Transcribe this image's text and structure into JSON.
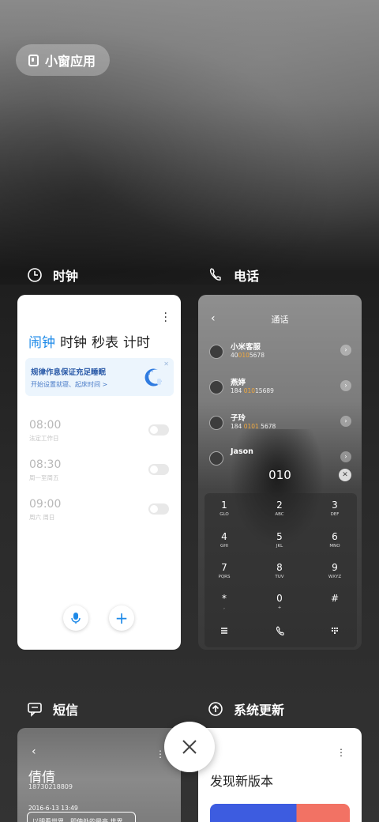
{
  "top": {
    "small_window_label": "小窗应用"
  },
  "labels": {
    "clock": "时钟",
    "phone": "电话",
    "sms": "短信",
    "update": "系统更新"
  },
  "clock": {
    "tabs": [
      "闹钟",
      "时钟",
      "秒表",
      "计时"
    ],
    "banner_title": "规律作息保证充足睡眠",
    "banner_sub": "开始设置就寝、起床时间 >",
    "alarms": [
      {
        "time": "08:00",
        "days": "法定工作日",
        "on": false
      },
      {
        "time": "08:30",
        "days": "周一至周五",
        "on": false
      },
      {
        "time": "09:00",
        "days": "周六 周日",
        "on": false
      }
    ],
    "add_symbol": "+"
  },
  "phone": {
    "title": "通话",
    "contacts": [
      {
        "name": "小米客服",
        "num_pre": "40",
        "num_hl": "010",
        "num_post": "5678"
      },
      {
        "name": "燕婷",
        "num_pre": "184 ",
        "num_hl": "010",
        "num_post": "15689"
      },
      {
        "name": "子玲",
        "num_pre": "184 ",
        "num_hl": "0101",
        "num_post": " 5678"
      },
      {
        "name": "Jason",
        "num_pre": "",
        "num_hl": "",
        "num_post": ""
      }
    ],
    "dialed": "010",
    "keys": [
      {
        "d": "1",
        "l": "GLO"
      },
      {
        "d": "2",
        "l": "ABC"
      },
      {
        "d": "3",
        "l": "DEF"
      },
      {
        "d": "4",
        "l": "GHI"
      },
      {
        "d": "5",
        "l": "JKL"
      },
      {
        "d": "6",
        "l": "MNO"
      },
      {
        "d": "7",
        "l": "PQRS"
      },
      {
        "d": "8",
        "l": "TUV"
      },
      {
        "d": "9",
        "l": "WXYZ"
      },
      {
        "d": "*",
        "l": ","
      },
      {
        "d": "0",
        "l": "+"
      },
      {
        "d": "#",
        "l": ""
      }
    ]
  },
  "sms": {
    "name": "倩倩",
    "number": "18730218809",
    "date": "2016-6-13 13:49",
    "preview": "以明看世界，即使处的最高 世界"
  },
  "update": {
    "headline": "发现新版本"
  },
  "colors": {
    "accent": "#1e8ae8",
    "highlight": "#f3a93d"
  }
}
